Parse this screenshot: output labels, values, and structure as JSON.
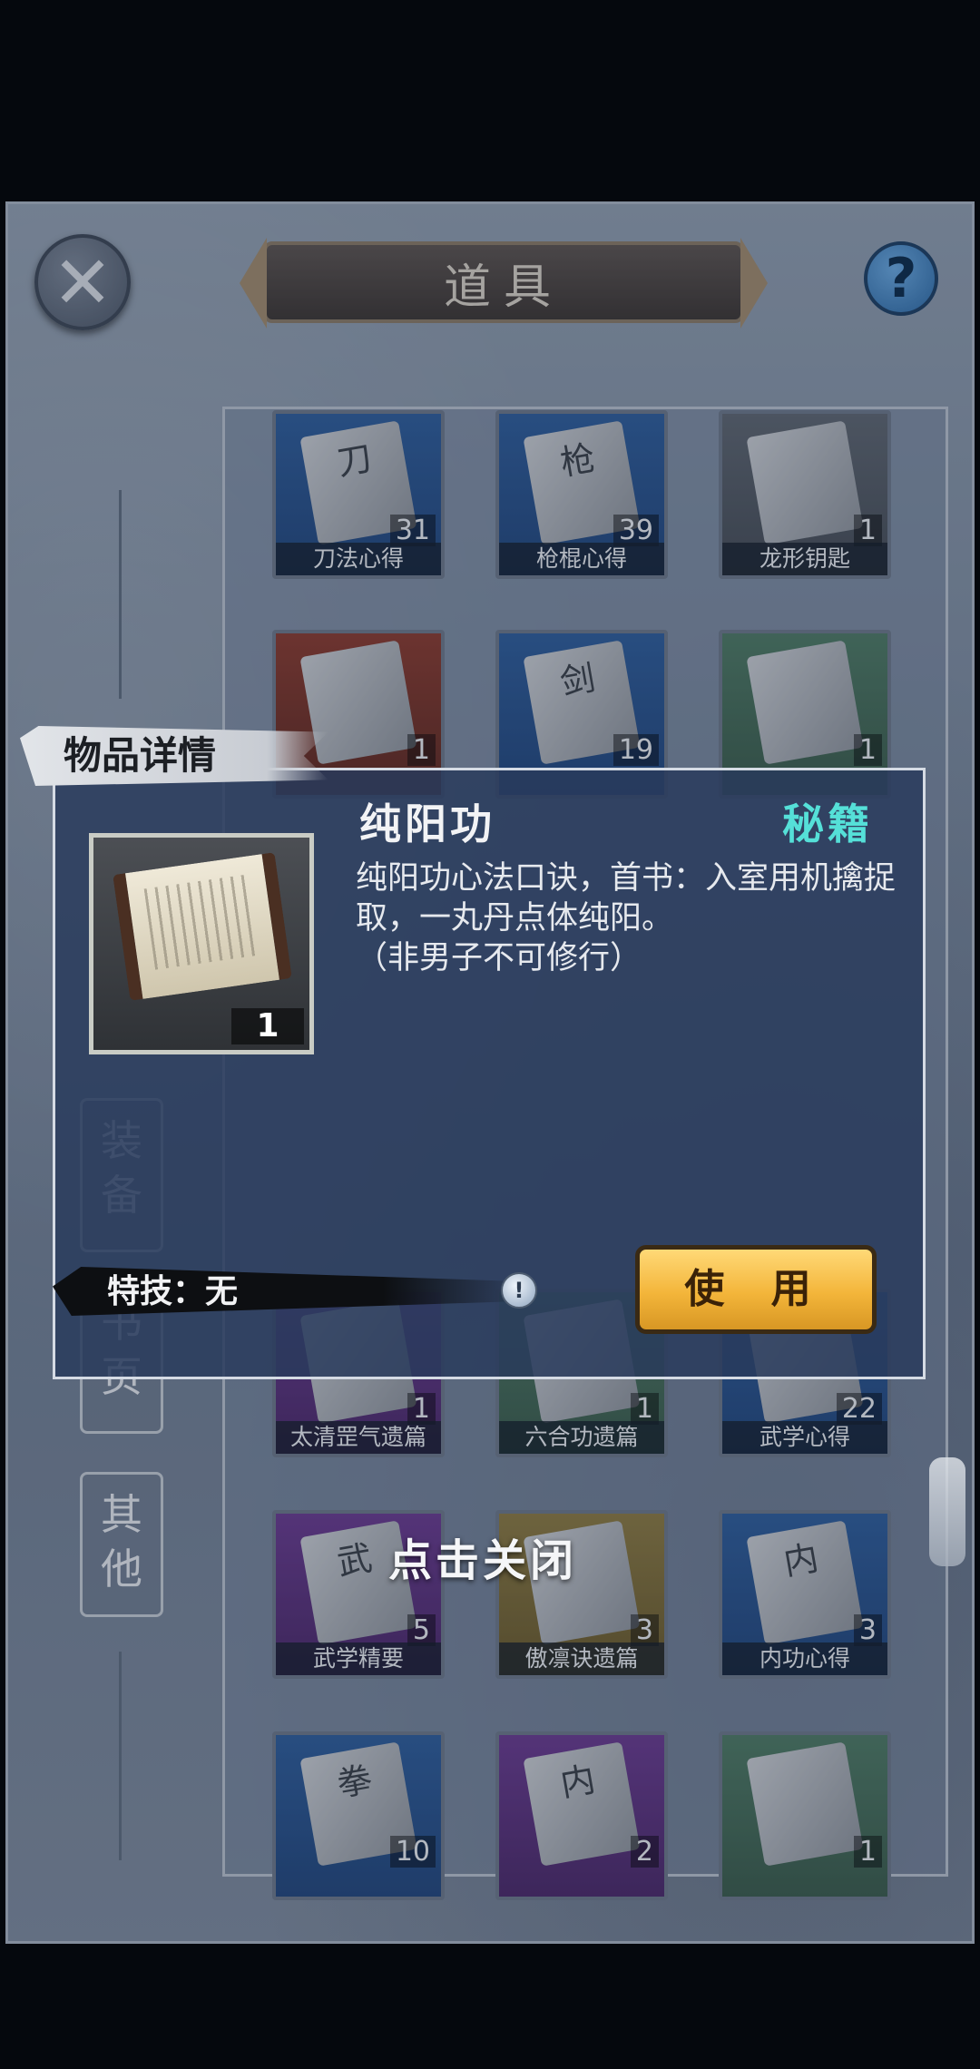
{
  "header": {
    "title": "道具",
    "close_icon": "close-icon",
    "help_icon": "help-icon"
  },
  "sidebar": {
    "tabs": [
      {
        "label": "装备"
      },
      {
        "label": "书页"
      },
      {
        "label": "其他"
      }
    ]
  },
  "inventory": {
    "items": [
      {
        "name": "刀法心得",
        "count": "31",
        "glyph": "刀",
        "rarity": "blue"
      },
      {
        "name": "枪棍心得",
        "count": "39",
        "glyph": "枪",
        "rarity": "blue"
      },
      {
        "name": "龙形钥匙",
        "count": "1",
        "glyph": "",
        "rarity": "gray"
      },
      {
        "name": "",
        "count": "1",
        "glyph": "",
        "rarity": "red"
      },
      {
        "name": "",
        "count": "19",
        "glyph": "剑",
        "rarity": "blue"
      },
      {
        "name": "",
        "count": "1",
        "glyph": "",
        "rarity": "green"
      },
      {
        "name": "太清罡气遗篇",
        "count": "1",
        "glyph": "",
        "rarity": "purple"
      },
      {
        "name": "六合功遗篇",
        "count": "1",
        "glyph": "",
        "rarity": "green"
      },
      {
        "name": "武学心得",
        "count": "22",
        "glyph": "",
        "rarity": "blue"
      },
      {
        "name": "武学精要",
        "count": "5",
        "glyph": "武",
        "rarity": "purple"
      },
      {
        "name": "傲凛诀遗篇",
        "count": "3",
        "glyph": "",
        "rarity": "gold"
      },
      {
        "name": "内功心得",
        "count": "3",
        "glyph": "内",
        "rarity": "blue"
      },
      {
        "name": "",
        "count": "10",
        "glyph": "拳",
        "rarity": "blue"
      },
      {
        "name": "",
        "count": "2",
        "glyph": "内",
        "rarity": "purple"
      },
      {
        "name": "",
        "count": "1",
        "glyph": "",
        "rarity": "green"
      }
    ]
  },
  "detail": {
    "tag": "物品详情",
    "item_name": "纯阳功",
    "item_type": "秘籍",
    "count": "1",
    "description_line1": "纯阳功心法口诀，首书：入室用机擒捉取，一丸丹点体纯阳。",
    "description_line2": "（非男子不可修行）",
    "skill_label": "特技：无",
    "use_button": "使 用",
    "type_color": "#55e0d8",
    "icon": "scroll-icon"
  },
  "footer": {
    "tap_to_close": "点击关闭"
  }
}
